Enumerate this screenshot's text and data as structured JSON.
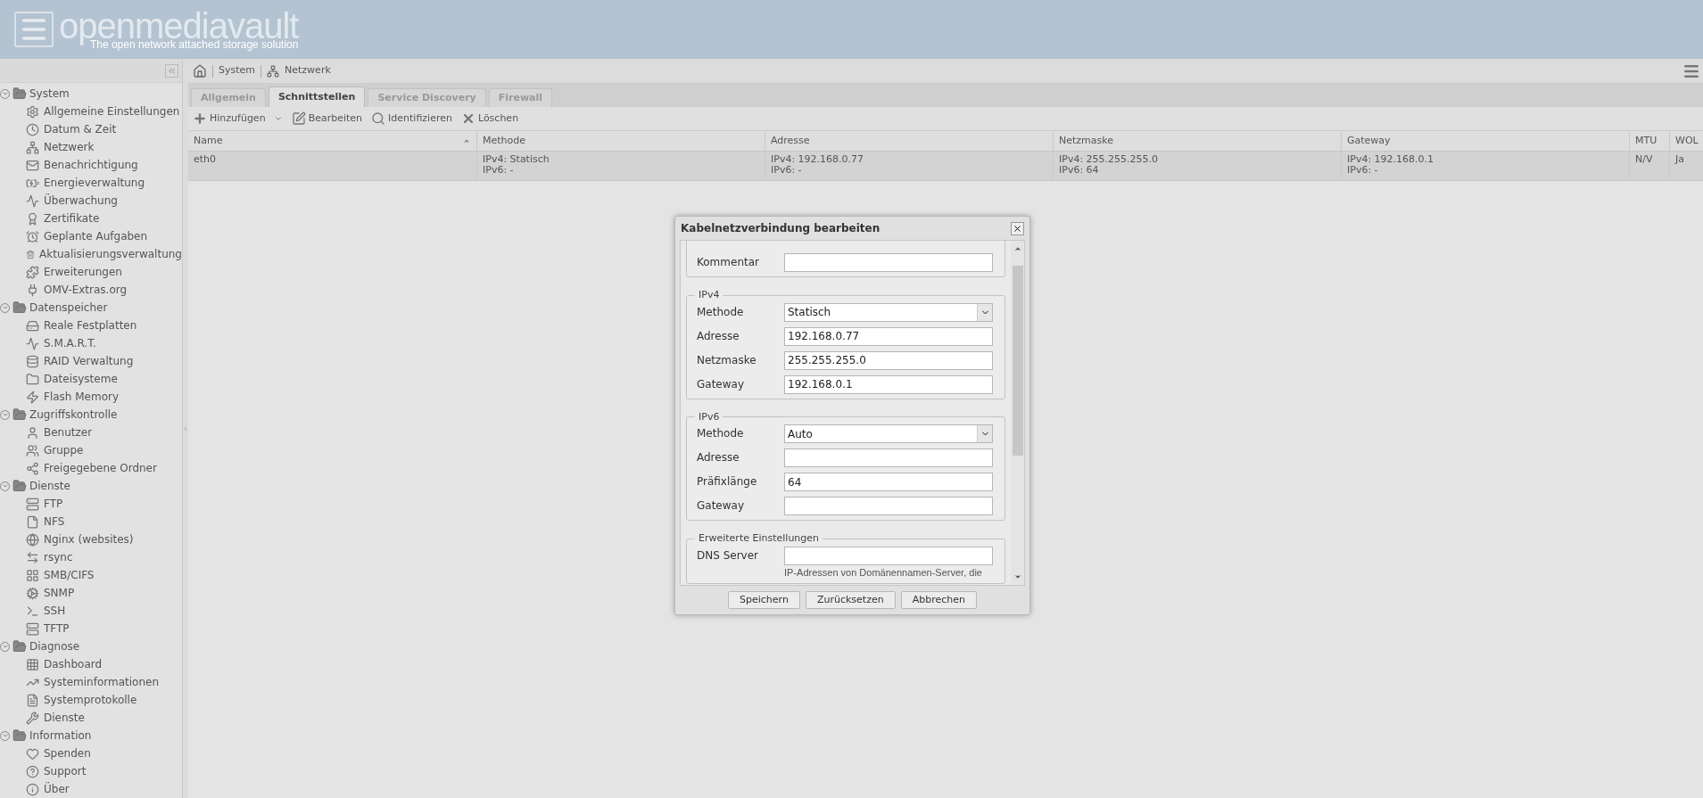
{
  "header": {
    "logo": "openmediavault",
    "tagline": "The open network attached storage solution"
  },
  "sidebar": {
    "groups": [
      {
        "label": "System",
        "expanded": true,
        "children": [
          {
            "label": "Allgemeine Einstellungen"
          },
          {
            "label": "Datum & Zeit"
          },
          {
            "label": "Netzwerk"
          },
          {
            "label": "Benachrichtigung"
          },
          {
            "label": "Energieverwaltung"
          },
          {
            "label": "Überwachung"
          },
          {
            "label": "Zertifikate"
          },
          {
            "label": "Geplante Aufgaben"
          },
          {
            "label": "Aktualisierungsverwaltung"
          },
          {
            "label": "Erweiterungen"
          },
          {
            "label": "OMV-Extras.org"
          }
        ]
      },
      {
        "label": "Datenspeicher",
        "expanded": true,
        "children": [
          {
            "label": "Reale Festplatten"
          },
          {
            "label": "S.M.A.R.T."
          },
          {
            "label": "RAID Verwaltung"
          },
          {
            "label": "Dateisysteme"
          },
          {
            "label": "Flash Memory"
          }
        ]
      },
      {
        "label": "Zugriffskontrolle",
        "expanded": true,
        "children": [
          {
            "label": "Benutzer"
          },
          {
            "label": "Gruppe"
          },
          {
            "label": "Freigegebene Ordner"
          }
        ]
      },
      {
        "label": "Dienste",
        "expanded": true,
        "children": [
          {
            "label": "FTP"
          },
          {
            "label": "NFS"
          },
          {
            "label": "Nginx (websites)"
          },
          {
            "label": "rsync"
          },
          {
            "label": "SMB/CIFS"
          },
          {
            "label": "SNMP"
          },
          {
            "label": "SSH"
          },
          {
            "label": "TFTP"
          }
        ]
      },
      {
        "label": "Diagnose",
        "expanded": true,
        "children": [
          {
            "label": "Dashboard"
          },
          {
            "label": "Systeminformationen"
          },
          {
            "label": "Systemprotokolle"
          },
          {
            "label": "Dienste"
          }
        ]
      },
      {
        "label": "Information",
        "expanded": true,
        "children": [
          {
            "label": "Spenden"
          },
          {
            "label": "Support"
          },
          {
            "label": "Über"
          }
        ]
      }
    ]
  },
  "breadcrumb": [
    "System",
    "Netzwerk"
  ],
  "tabs": [
    {
      "label": "Allgemein",
      "selected": false
    },
    {
      "label": "Schnittstellen",
      "selected": true
    },
    {
      "label": "Service Discovery",
      "selected": false
    },
    {
      "label": "Firewall",
      "selected": false
    }
  ],
  "toolbar": [
    "Hinzufügen",
    "Bearbeiten",
    "Identifizieren",
    "Löschen"
  ],
  "table": {
    "columns": [
      {
        "label": "Name",
        "sorted": true
      },
      {
        "label": "Methode",
        "sorted": false
      },
      {
        "label": "Adresse",
        "sorted": false
      },
      {
        "label": "Netzmaske",
        "sorted": false
      },
      {
        "label": "Gateway",
        "sorted": false
      },
      {
        "label": "MTU",
        "sorted": false
      },
      {
        "label": "WOL",
        "sorted": false
      }
    ],
    "rows": [
      {
        "selected": true,
        "cells": [
          [
            "eth0"
          ],
          [
            "IPv4: Statisch",
            "IPv6: -"
          ],
          [
            "IPv4: 192.168.0.77",
            "IPv6: -"
          ],
          [
            "IPv4: 255.255.255.0",
            "IPv6: 64"
          ],
          [
            "IPv4: 192.168.0.1",
            "IPv6: -"
          ],
          [
            "N/V"
          ],
          [
            "Ja"
          ]
        ]
      }
    ]
  },
  "dialog": {
    "title": "Kabelnetzverbindung bearbeiten",
    "sections": [
      {
        "fields": [
          {
            "kind": "text",
            "label": "Kommentar"
          }
        ]
      },
      {
        "legend": "IPv4",
        "fields": [
          {
            "kind": "select",
            "label": "Methode",
            "value": "Statisch"
          },
          {
            "kind": "text",
            "label": "Adresse",
            "value": "192.168.0.77"
          },
          {
            "kind": "text",
            "label": "Netzmaske",
            "value": "255.255.255.0"
          },
          {
            "kind": "text",
            "label": "Gateway",
            "value": "192.168.0.1"
          }
        ]
      },
      {
        "legend": "IPv6",
        "fields": [
          {
            "kind": "select",
            "label": "Methode",
            "value": "Auto"
          },
          {
            "kind": "text",
            "label": "Adresse"
          },
          {
            "kind": "text",
            "label": "Präfixlänge",
            "value": "64"
          },
          {
            "kind": "text",
            "label": "Gateway"
          }
        ]
      },
      {
        "legend": "Erweiterte Einstellungen",
        "fields": [
          {
            "kind": "text",
            "label": "DNS Server",
            "help": "IP-Adressen von Domänennamen-Server, die"
          }
        ]
      }
    ],
    "buttons": [
      "Speichern",
      "Zurücksetzen",
      "Abbrechen"
    ]
  }
}
